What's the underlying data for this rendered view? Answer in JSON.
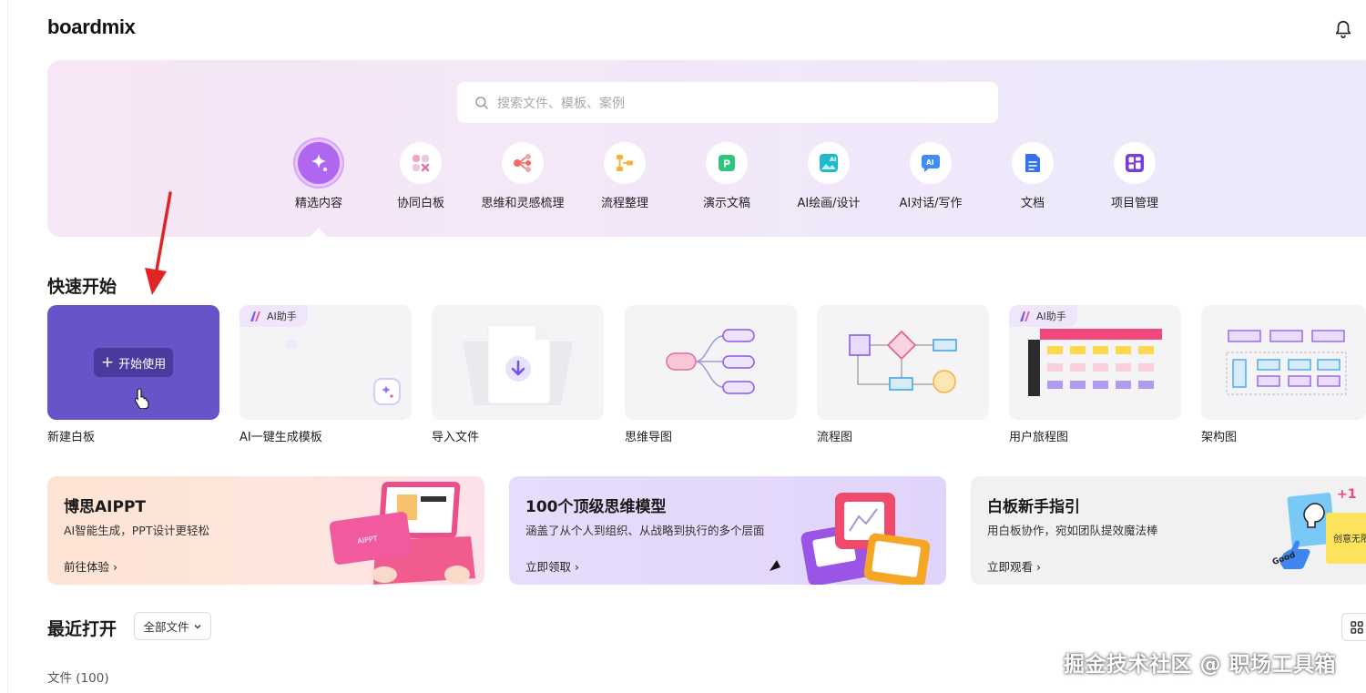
{
  "app": {
    "logo": "boardmix"
  },
  "search": {
    "placeholder": "搜索文件、模板、案例"
  },
  "categories": [
    {
      "label": "精选内容",
      "icon": "sparkle-icon",
      "active": true
    },
    {
      "label": "协同白板",
      "icon": "whiteboard-icon"
    },
    {
      "label": "思维和灵感梳理",
      "icon": "mindmap-icon"
    },
    {
      "label": "流程整理",
      "icon": "flow-icon"
    },
    {
      "label": "演示文稿",
      "icon": "presentation-icon"
    },
    {
      "label": "AI绘画/设计",
      "icon": "ai-image-icon"
    },
    {
      "label": "AI对话/写作",
      "icon": "ai-chat-icon"
    },
    {
      "label": "文档",
      "icon": "document-icon"
    },
    {
      "label": "项目管理",
      "icon": "kanban-icon"
    }
  ],
  "quickstart": {
    "title": "快速开始",
    "start_button": "开始使用",
    "ai_tag": "AI助手",
    "cards": [
      {
        "label": "新建白板"
      },
      {
        "label": "AI一键生成模板"
      },
      {
        "label": "导入文件"
      },
      {
        "label": "思维导图"
      },
      {
        "label": "流程图"
      },
      {
        "label": "用户旅程图"
      },
      {
        "label": "架构图"
      }
    ]
  },
  "banners": [
    {
      "title": "博思AIPPT",
      "subtitle": "AI智能生成，PPT设计更轻松",
      "link": "前往体验",
      "art_text": "AIPPT"
    },
    {
      "title": "100个顶级思维模型",
      "subtitle": "涵盖了从个人到组织、从战略到执行的多个层面",
      "link": "立即领取"
    },
    {
      "title": "白板新手指引",
      "subtitle": "用白板协作，宛如团队提效魔法棒",
      "link": "立即观看",
      "art_text": "创意无限",
      "badge": "+1"
    }
  ],
  "recent": {
    "title": "最近打开",
    "filter": "全部文件",
    "count_text": "文件 (100)"
  },
  "watermark": "掘金技术社区 @ 职场工具箱",
  "colors": {
    "accent": "#6853c8",
    "active_category": "#b067f0",
    "annotation_arrow": "#e02424"
  }
}
